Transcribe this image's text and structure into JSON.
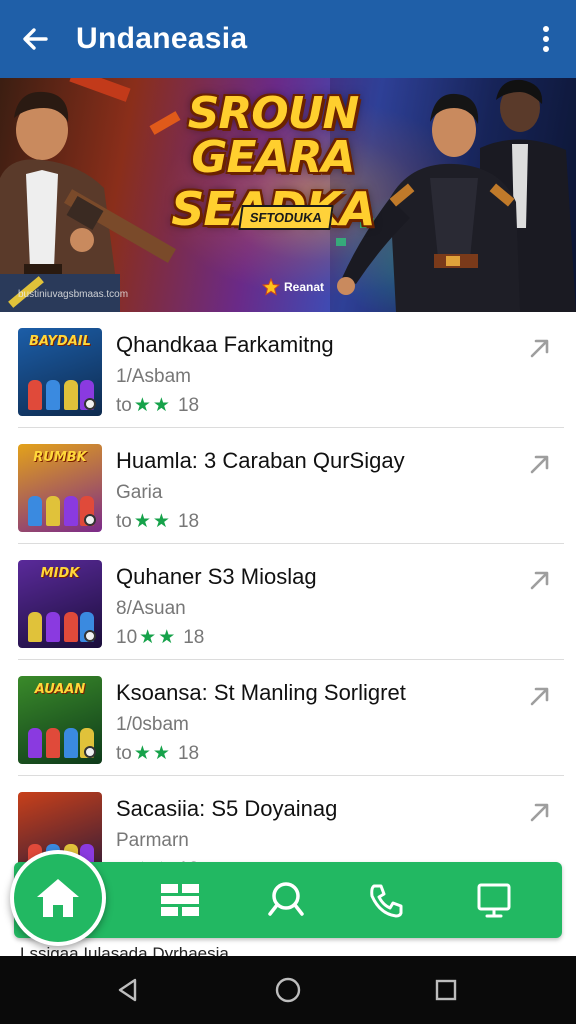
{
  "appbar": {
    "title": "Undaneasia",
    "back_icon": "arrow-left-icon",
    "menu_icon": "more-vertical-icon"
  },
  "banner": {
    "headline_line1": "SROUN GEARA",
    "headline_line2": "SEADKA",
    "tag": "SFTODUKA",
    "caption": "bustiniuvagsbmaas.tcom",
    "brand": "Reanat"
  },
  "items": [
    {
      "name": "Qhandkaa Farkamitng",
      "sub": "1/Asbam",
      "rating_prefix": "to",
      "stars": 2,
      "rating_suffix": "18",
      "thumb_title": "BAYDAIL",
      "thumb_colors": [
        "#1c5ea8",
        "#0e2a4e"
      ]
    },
    {
      "name": "Huamla: 3 Caraban QurSigay",
      "sub": "Garia",
      "rating_prefix": "to",
      "stars": 2,
      "rating_suffix": "18",
      "thumb_title": "RUMBK",
      "thumb_colors": [
        "#e3a21a",
        "#7b2a8a"
      ]
    },
    {
      "name": "Quhaner S3 Mioslag",
      "sub": "8/Asuan",
      "rating_prefix": "10",
      "stars": 2,
      "rating_suffix": "18",
      "thumb_title": "MIDK",
      "thumb_colors": [
        "#5a2a9a",
        "#1a0e3a"
      ]
    },
    {
      "name": "Ksoansa: St Manling Sorligret",
      "sub": "1/0sbam",
      "rating_prefix": "to",
      "stars": 2,
      "rating_suffix": "18",
      "thumb_title": "AUAAN",
      "thumb_colors": [
        "#3a8a2a",
        "#0e3a1a"
      ]
    },
    {
      "name": "Sacasiia: S5 Doyainag",
      "sub": "Parmarn",
      "rating_prefix": "to",
      "stars": 2,
      "rating_suffix": "18",
      "thumb_title": "",
      "thumb_colors": [
        "#c8401a",
        "#2a1a3a"
      ]
    }
  ],
  "bottom_nav": {
    "home_icon": "home-icon",
    "grid_icon": "grid-icon",
    "search_icon": "search-icon",
    "phone_icon": "phone-icon",
    "screen_icon": "monitor-icon"
  },
  "footer_text": "Lssigaa Iulasada Dyrhaesia",
  "system_nav": {
    "back_icon": "triangle-back-icon",
    "home_icon": "circle-home-icon",
    "recents_icon": "square-recents-icon"
  },
  "colors": {
    "appbar": "#1f5fa8",
    "accent_green": "#22b862",
    "star": "#16a24a"
  }
}
